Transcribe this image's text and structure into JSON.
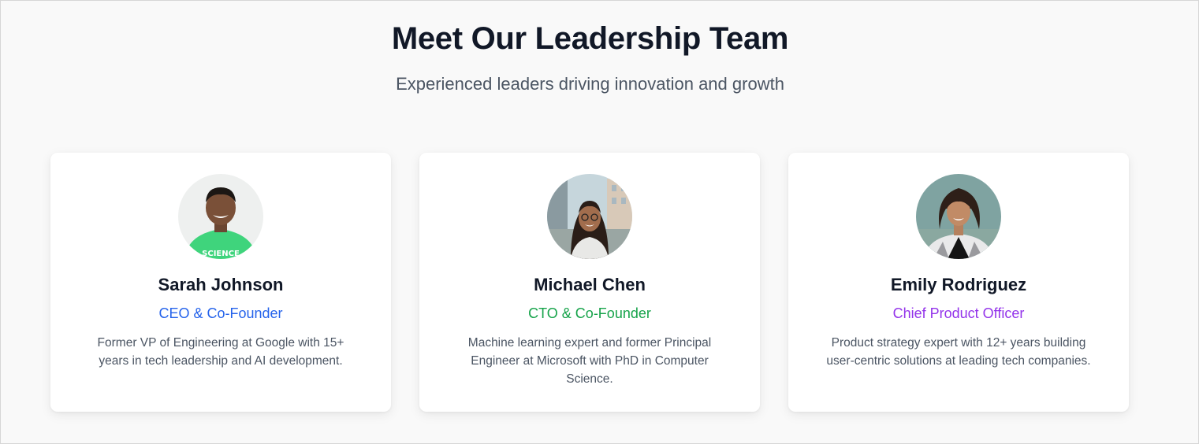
{
  "section": {
    "title": "Meet Our Leadership Team",
    "subtitle": "Experienced leaders driving innovation and growth"
  },
  "team": [
    {
      "name": "Sarah Johnson",
      "role": "CEO & Co-Founder",
      "role_color": "#2563eb",
      "bio": "Former VP of Engineering at Google with 15+ years in tech leadership and AI development.",
      "photo": "man-green-shirt-portrait"
    },
    {
      "name": "Michael Chen",
      "role": "CTO & Co-Founder",
      "role_color": "#16a34a",
      "bio": "Machine learning expert and former Principal Engineer at Microsoft with PhD in Computer Science.",
      "photo": "woman-street-portrait"
    },
    {
      "name": "Emily Rodriguez",
      "role": "Chief Product Officer",
      "role_color": "#9333ea",
      "bio": "Product strategy expert with 12+ years building user-centric solutions at leading tech companies.",
      "photo": "woman-blazer-portrait"
    }
  ]
}
